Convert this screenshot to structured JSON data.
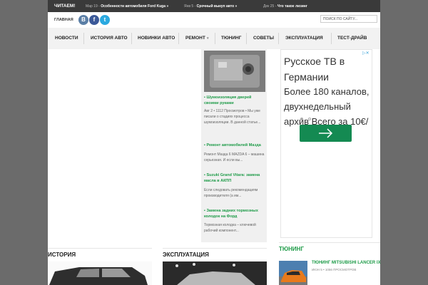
{
  "topbar": {
    "reading_label": "ЧИТАЕМ!",
    "ticker": [
      {
        "date": "Мар 19 -",
        "title": "Особенности автомобиля Ford Kuga »"
      },
      {
        "date": "Янв 5 -",
        "title": "Срочный выкуп авто »"
      },
      {
        "date": "Дек 25 -",
        "title": "Что такое лизинг"
      }
    ]
  },
  "header": {
    "home_label": "ГЛАВНАЯ",
    "social": [
      {
        "icon": "vk-icon",
        "glyph": "В",
        "color": "#5b7fa6"
      },
      {
        "icon": "facebook-icon",
        "glyph": "f",
        "color": "#3b5998"
      },
      {
        "icon": "twitter-icon",
        "glyph": "t",
        "color": "#2aa9e0"
      }
    ],
    "search_placeholder": "ПОИСК ПО САЙТУ..."
  },
  "nav": {
    "items": [
      {
        "label": "НОВОСТИ"
      },
      {
        "label": "ИСТОРИЯ АВТО"
      },
      {
        "label": "НОВИНКИ АВТО"
      },
      {
        "label": "РЕМОНТ"
      },
      {
        "label": "ТЮНИНГ"
      },
      {
        "label": "СОВЕТЫ"
      },
      {
        "label": "ЭКСПЛУАТАЦИЯ"
      },
      {
        "label": "ТЕСТ-ДРАЙВ"
      }
    ]
  },
  "posts": [
    {
      "title": "Шумоизоляция дверей своими руками",
      "meta": "Авг 2 • 1112 Просмотров • Мы уже писали о стадиях процесса шумоизоляции. В данной статье..."
    },
    {
      "title": "Ремонт автомобилей Мазда",
      "meta": "Ремонт Мазда 6 MAZDA 6 – машина серьезная. И если вы..."
    },
    {
      "title": "Suzuki Grand Vitara: замена масла в АКПП",
      "meta": "Если следовать рекомендациям производителя (а им..."
    },
    {
      "title": "Замена задних тормозных колодок на Форд",
      "meta": "Тормозная колодка – ключевой рабочий компонент..."
    }
  ],
  "ad": {
    "text": "Русское ТВ в Германии",
    "sub": "Более 180 каналов, двухнедельный архив Всего за 10€/",
    "button_color": "#148a52"
  },
  "sections": {
    "history": "ИСТОРИЯ",
    "operation": "ЭКСПЛУАТАЦИЯ",
    "tuning": "ТЮНИНГ"
  },
  "tuning_post": {
    "title": "ТЮНИНГ MITSUBISHI LANCER IX",
    "meta": "ИЮН 5 • 1056 ПРОСМОТРОВ"
  },
  "colors": {
    "accent": "#1e9b48",
    "topbar": "#3a3a3a"
  }
}
